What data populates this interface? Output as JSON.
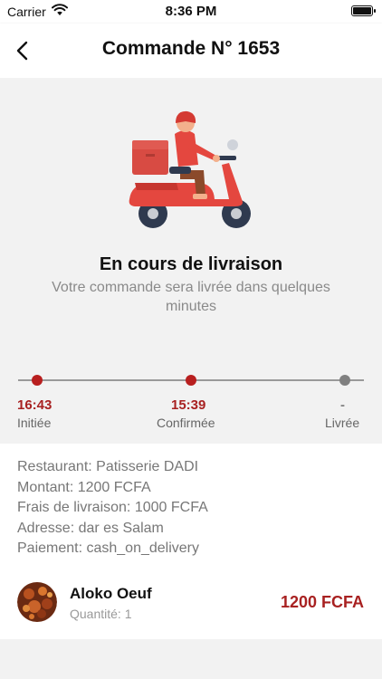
{
  "status_bar": {
    "carrier": "Carrier",
    "time": "8:36 PM"
  },
  "nav": {
    "title": "Commande N° 1653"
  },
  "delivery": {
    "status_title": "En cours de livraison",
    "status_subtitle": "Votre commande sera livrée dans quelques minutes"
  },
  "timeline": [
    {
      "time": "16:43",
      "label": "Initiée",
      "done": true
    },
    {
      "time": "15:39",
      "label": "Confirmée",
      "done": true
    },
    {
      "time": "-",
      "label": "Livrée",
      "done": false
    }
  ],
  "details": {
    "restaurant": "Restaurant: Patisserie DADI",
    "amount": "Montant: 1200 FCFA",
    "delivery_fee": "Frais de livraison: 1000 FCFA",
    "address": "Adresse: dar es Salam",
    "payment": "Paiement: cash_on_delivery"
  },
  "item": {
    "name": "Aloko Oeuf",
    "quantity": "Quantité: 1",
    "price": "1200 FCFA"
  },
  "colors": {
    "accent": "#a82121",
    "pending": "#808080",
    "background": "#f2f2f2"
  },
  "icons": {
    "back": "chevron-left-icon",
    "wifi": "wifi-icon",
    "battery": "battery-icon"
  }
}
